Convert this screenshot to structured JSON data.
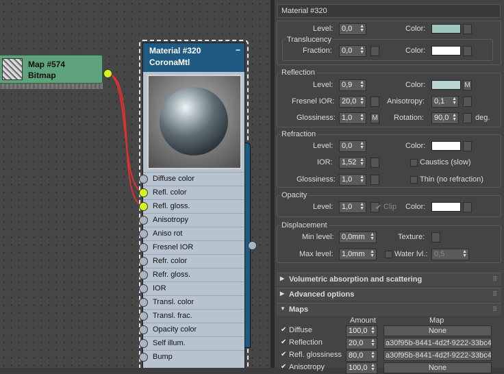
{
  "map_node": {
    "title": "Map #574",
    "type": "Bitmap"
  },
  "material_node": {
    "title": "Material #320",
    "type": "CoronaMtl",
    "minimize": "−",
    "slots": [
      "Diffuse color",
      "Refl. color",
      "Refl. gloss.",
      "Anisotropy",
      "Aniso rot",
      "Fresnel IOR",
      "Refr. color",
      "Refr. gloss.",
      "IOR",
      "Transl. color",
      "Transl. frac.",
      "Opacity color",
      "Self illum.",
      "Bump"
    ]
  },
  "panel": {
    "title": "Material #320",
    "diffuse": {
      "level_label": "Level:",
      "level": "0,0",
      "color_label": "Color:",
      "swatch": "#9fc7c0"
    },
    "translucency": {
      "label": "Translucency",
      "fraction_label": "Fraction:",
      "fraction": "0,0",
      "color_label": "Color:",
      "swatch": "#ffffff"
    },
    "reflection": {
      "label": "Reflection",
      "level_label": "Level:",
      "level": "0,9",
      "color_label": "Color:",
      "swatch": "#b9d6d2",
      "color_map": "M",
      "fresnel_label": "Fresnel IOR:",
      "fresnel": "20,0",
      "aniso_label": "Anisotropy:",
      "aniso": "0,1",
      "gloss_label": "Glossiness:",
      "gloss": "1,0",
      "gloss_map": "M",
      "rot_label": "Rotation:",
      "rot": "90,0",
      "deg": "deg."
    },
    "refraction": {
      "label": "Refraction",
      "level_label": "Level:",
      "level": "0,0",
      "color_label": "Color:",
      "swatch": "#ffffff",
      "ior_label": "IOR:",
      "ior": "1,52",
      "caustics": "Caustics (slow)",
      "gloss_label": "Glossiness:",
      "gloss": "1,0",
      "thin": "Thin (no refraction)"
    },
    "opacity": {
      "label": "Opacity",
      "level_label": "Level:",
      "level": "1,0",
      "clip": "Clip",
      "color_label": "Color:",
      "swatch": "#ffffff"
    },
    "displacement": {
      "label": "Displacement",
      "min_label": "Min level:",
      "min": "0,0mm",
      "texture_label": "Texture:",
      "max_label": "Max level:",
      "max": "1,0mm",
      "water_label": "Water lvl.:",
      "water": "0,5"
    },
    "rollouts": [
      "Volumetric absorption and scattering",
      "Advanced options",
      "Maps"
    ],
    "maps": {
      "amount_header": "Amount",
      "map_header": "Map",
      "rows": [
        {
          "name": "Diffuse",
          "amount": "100,0",
          "map": "None"
        },
        {
          "name": "Reflection",
          "amount": "20,0",
          "map": "a30f95b-8441-4d2f-9222-33bc4"
        },
        {
          "name": "Refl. glossiness",
          "amount": "80,0",
          "map": "a30f95b-8441-4d2f-9222-33bc4"
        },
        {
          "name": "Anisotropy",
          "amount": "100,0",
          "map": "None"
        }
      ]
    }
  }
}
